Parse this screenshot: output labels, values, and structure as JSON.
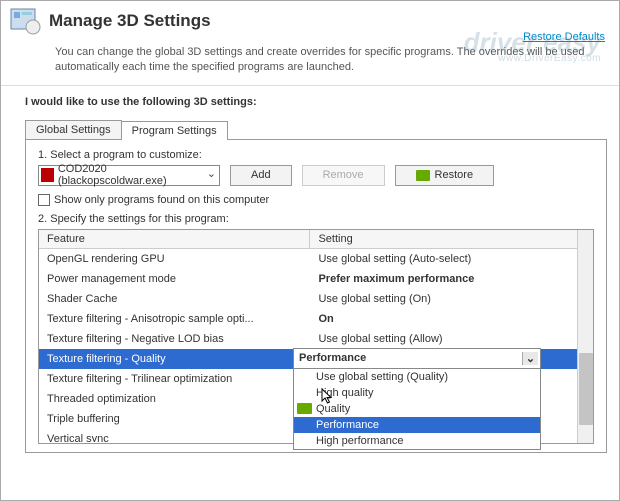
{
  "header": {
    "title": "Manage 3D Settings",
    "restore": "Restore Defaults"
  },
  "subtext": "You can change the global 3D settings and create overrides for specific programs. The overrides will be used automatically each time the specified programs are launched.",
  "section_label": "I would like to use the following 3D settings:",
  "tabs": {
    "global": "Global Settings",
    "program": "Program Settings"
  },
  "step1": "1. Select a program to customize:",
  "program_selected": "COD2020 (blackopscoldwar.exe)",
  "buttons": {
    "add": "Add",
    "remove": "Remove",
    "restore": "Restore"
  },
  "show_only": "Show only programs found on this computer",
  "step2": "2. Specify the settings for this program:",
  "columns": {
    "feature": "Feature",
    "setting": "Setting"
  },
  "rows": [
    {
      "feature": "OpenGL rendering GPU",
      "setting": "Use global setting (Auto-select)",
      "bold": false
    },
    {
      "feature": "Power management mode",
      "setting": "Prefer maximum performance",
      "bold": true
    },
    {
      "feature": "Shader Cache",
      "setting": "Use global setting (On)",
      "bold": false
    },
    {
      "feature": "Texture filtering - Anisotropic sample opti...",
      "setting": "On",
      "bold": true
    },
    {
      "feature": "Texture filtering - Negative LOD bias",
      "setting": "Use global setting (Allow)",
      "bold": false
    },
    {
      "feature": "Texture filtering - Quality",
      "setting": "Performance",
      "bold": true,
      "selected": true
    },
    {
      "feature": "Texture filtering - Trilinear optimization",
      "setting": "",
      "bold": false
    },
    {
      "feature": "Threaded optimization",
      "setting": "",
      "bold": false
    },
    {
      "feature": "Triple buffering",
      "setting": "",
      "bold": false
    },
    {
      "feature": "Vertical sync",
      "setting": "",
      "bold": false
    }
  ],
  "dropdown": {
    "selected_value": "Performance",
    "options": [
      "Use global setting (Quality)",
      "High quality",
      "Quality",
      "Performance",
      "High performance"
    ],
    "hover_index": 3,
    "nvidia_index": 2
  },
  "watermark": {
    "brand": "driver easy",
    "url": "www.DriverEasy.com"
  }
}
